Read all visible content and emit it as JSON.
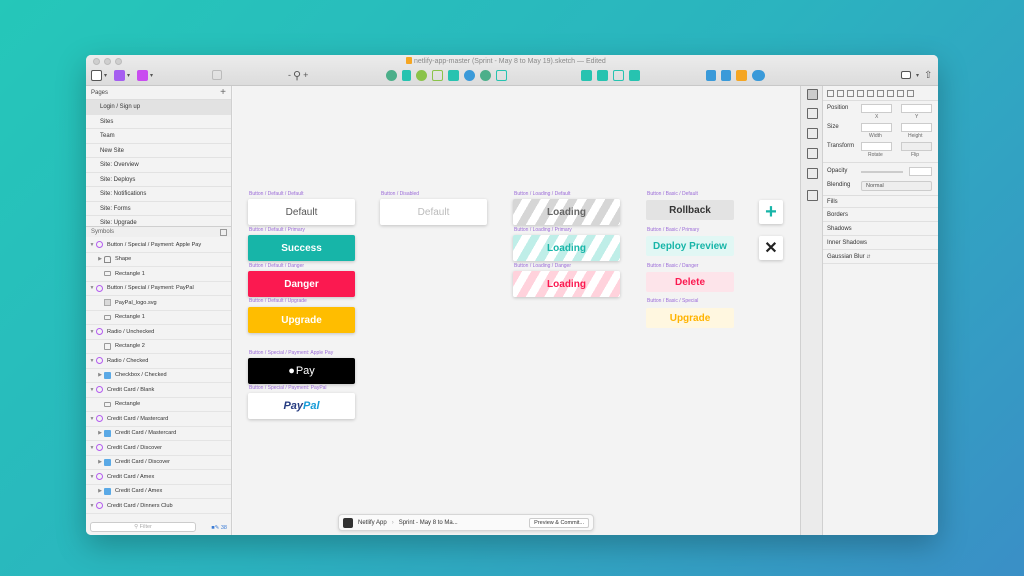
{
  "window": {
    "title": "netlify-app-master (Sprint - May 8 to May 19).sketch",
    "edited": "— Edited"
  },
  "toolbar": {
    "zoom_minus": "-",
    "zoom_plus": "+"
  },
  "pages": {
    "header": "Pages",
    "add": "+",
    "items": [
      "Login / Sign up",
      "Sites",
      "Team",
      "New Site",
      "Site: Overview",
      "Site: Deploys",
      "Site: Notifications",
      "Site: Forms",
      "Site: Upgrade"
    ]
  },
  "symbols": {
    "header": "Symbols",
    "layers": [
      {
        "label": "Button / Special / Payment: Apple Pay",
        "indent": 0,
        "icon": "symbol-icon",
        "open": true
      },
      {
        "label": "Shape",
        "indent": 1,
        "icon": "shape-icon",
        "open": false
      },
      {
        "label": "Rectangle 1",
        "indent": 1,
        "icon": "rectangle-icon",
        "open": null
      },
      {
        "label": "Button / Special / Payment: PayPal",
        "indent": 0,
        "icon": "symbol-icon",
        "open": true
      },
      {
        "label": "PayPal_logo.svg",
        "indent": 1,
        "icon": "image-icon",
        "open": null
      },
      {
        "label": "Rectangle 1",
        "indent": 1,
        "icon": "rectangle-icon",
        "open": null
      },
      {
        "label": "Radio / Unchecked",
        "indent": 0,
        "icon": "symbol-icon",
        "open": true
      },
      {
        "label": "Rectangle 2",
        "indent": 1,
        "icon": "box-icon",
        "open": null
      },
      {
        "label": "Radio / Checked",
        "indent": 0,
        "icon": "symbol-icon",
        "open": true
      },
      {
        "label": "Checkbox / Checked",
        "indent": 1,
        "icon": "folder-icon",
        "open": false
      },
      {
        "label": "Credit Card / Blank",
        "indent": 0,
        "icon": "symbol-icon",
        "open": true
      },
      {
        "label": "Rectangle",
        "indent": 1,
        "icon": "rectangle-icon",
        "open": null
      },
      {
        "label": "Credit Card / Mastercard",
        "indent": 0,
        "icon": "symbol-icon",
        "open": true
      },
      {
        "label": "Credit Card / Mastercard",
        "indent": 1,
        "icon": "folder-icon",
        "open": false
      },
      {
        "label": "Credit Card / Discover",
        "indent": 0,
        "icon": "symbol-icon",
        "open": true
      },
      {
        "label": "Credit Card / Discover",
        "indent": 1,
        "icon": "folder-icon",
        "open": false
      },
      {
        "label": "Credit Card / Amex",
        "indent": 0,
        "icon": "symbol-icon",
        "open": true
      },
      {
        "label": "Credit Card / Amex",
        "indent": 1,
        "icon": "folder-icon",
        "open": false
      },
      {
        "label": "Credit Card / Dinners Club",
        "indent": 0,
        "icon": "symbol-icon",
        "open": true
      }
    ],
    "filter_placeholder": "Filter",
    "count": "38"
  },
  "canvas": {
    "buttons": {
      "default_label": "Button / Default / Default",
      "default": "Default",
      "disabled_label": "Button / Disabled",
      "disabled": "Default",
      "primary_label": "Button / Default / Primary",
      "primary": "Success",
      "danger_label": "Button / Default / Danger",
      "danger": "Danger",
      "upgrade_label": "Button / Default / Upgrade",
      "upgrade": "Upgrade",
      "applepay_label": "Button / Special / Payment: Apple Pay",
      "applepay": "Pay",
      "paypal_label": "Button / Special / Payment: PayPal",
      "paypal_a": "Pay",
      "paypal_b": "Pal",
      "loading_default_label": "Button / Loading / Default",
      "loading_default": "Loading",
      "loading_primary_label": "Button / Loading / Primary",
      "loading_primary": "Loading",
      "loading_danger_label": "Button / Loading / Danger",
      "loading_danger": "Loading",
      "basic_default_label": "Button / Basic / Default",
      "basic_default": "Rollback",
      "basic_primary_label": "Button / Basic / Primary",
      "basic_primary": "Deploy Preview",
      "basic_danger_label": "Button / Basic / Danger",
      "basic_danger": "Delete",
      "basic_special_label": "Button / Basic / Special",
      "basic_special": "Upgrade",
      "plus": "+",
      "close": "✕"
    },
    "colors": {
      "primary": "#17b5a8",
      "danger": "#fb1950",
      "upgrade": "#ffbd00"
    }
  },
  "bottombar": {
    "app": "Netlify App",
    "sprint": "Sprint - May 8 to Ma...",
    "preview": "Preview & Commit..."
  },
  "inspector": {
    "position": "Position",
    "x": "X",
    "y": "Y",
    "size": "Size",
    "width": "Width",
    "height": "Height",
    "transform": "Transform",
    "rotate": "Rotate",
    "flip": "Flip",
    "opacity": "Opacity",
    "blending": "Blending",
    "blending_value": "Normal",
    "fills": "Fills",
    "borders": "Borders",
    "shadows": "Shadows",
    "inner_shadows": "Inner Shadows",
    "gaussian_blur": "Gaussian Blur"
  }
}
